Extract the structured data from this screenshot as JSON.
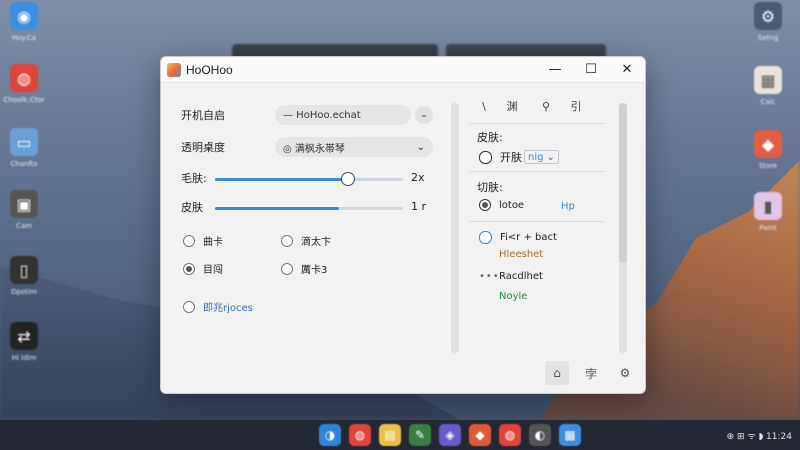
{
  "window": {
    "title": "HoOHoo",
    "controls": {
      "minimize": "—",
      "maximize": "☐",
      "close": "✕"
    }
  },
  "left": {
    "row1": {
      "label": "开机自启",
      "value": "— HoHoo.echat",
      "btn": "⌄"
    },
    "row2": {
      "label": "透明桌度",
      "value": "◎ 满枫永帯琴",
      "btn": "⌄"
    },
    "slider1": {
      "label": "毛肤:",
      "value_text": "2x",
      "fraction": 0.71
    },
    "slider2": {
      "label": "皮肤",
      "value_text": "1 r",
      "fraction": 0.66
    },
    "radios": [
      {
        "label": "曲卡",
        "checked": false
      },
      {
        "label": "滴太卞",
        "checked": false
      },
      {
        "label": "目闯",
        "checked": true
      },
      {
        "label": "厲卡3",
        "checked": false
      },
      {
        "label": "即兆rjoces",
        "checked": false
      }
    ]
  },
  "right": {
    "toolbar": [
      "\\",
      "渊",
      "⚲",
      "引"
    ],
    "skin_label": "皮肤:",
    "skin_option": "开肤",
    "skin_select": "nig",
    "switch_label": "切肤:",
    "lotoe": {
      "label": "lotoe",
      "extra": "Hp"
    },
    "option_a": {
      "label": "Fi<r + bact",
      "sub": "Hleeshet"
    },
    "option_b": {
      "prefix": "•••",
      "label": "Racdlhet",
      "sub": "Noyle"
    }
  },
  "bottom_buttons": [
    "⌂",
    "孛",
    "⚙"
  ],
  "desktop": {
    "left_icons": [
      {
        "name": "Hoy.Ca",
        "icon": "◉",
        "color": "#3b8ee0"
      },
      {
        "name": "Choolk.Ctor",
        "icon": "◍",
        "color": "#e0453b"
      },
      {
        "name": "Chanfto",
        "icon": "▭",
        "color": "#6aa0d8"
      },
      {
        "name": "Cam",
        "icon": "▣",
        "color": "#555"
      },
      {
        "name": "Dpotim",
        "icon": "▯",
        "color": "#333"
      },
      {
        "name": "Hi ldim",
        "icon": "⇄",
        "color": "#222"
      }
    ],
    "right_icons": [
      {
        "name": "Setng",
        "icon": "⚙",
        "color": "#4a5a74"
      },
      {
        "name": "Calc",
        "icon": "▦",
        "color": "#e9e3d8"
      },
      {
        "name": "Store",
        "icon": "◆",
        "color": "#e45d42"
      },
      {
        "name": "Paint",
        "icon": "▮",
        "color": "#e3c4e6"
      }
    ],
    "tray_text": "⊕ ⊞ ᯤ ◗ 11:24"
  },
  "taskbar": [
    "◑",
    "◍",
    "▤",
    "✎",
    "◈",
    "◆",
    "◍",
    "◐",
    "▦"
  ]
}
